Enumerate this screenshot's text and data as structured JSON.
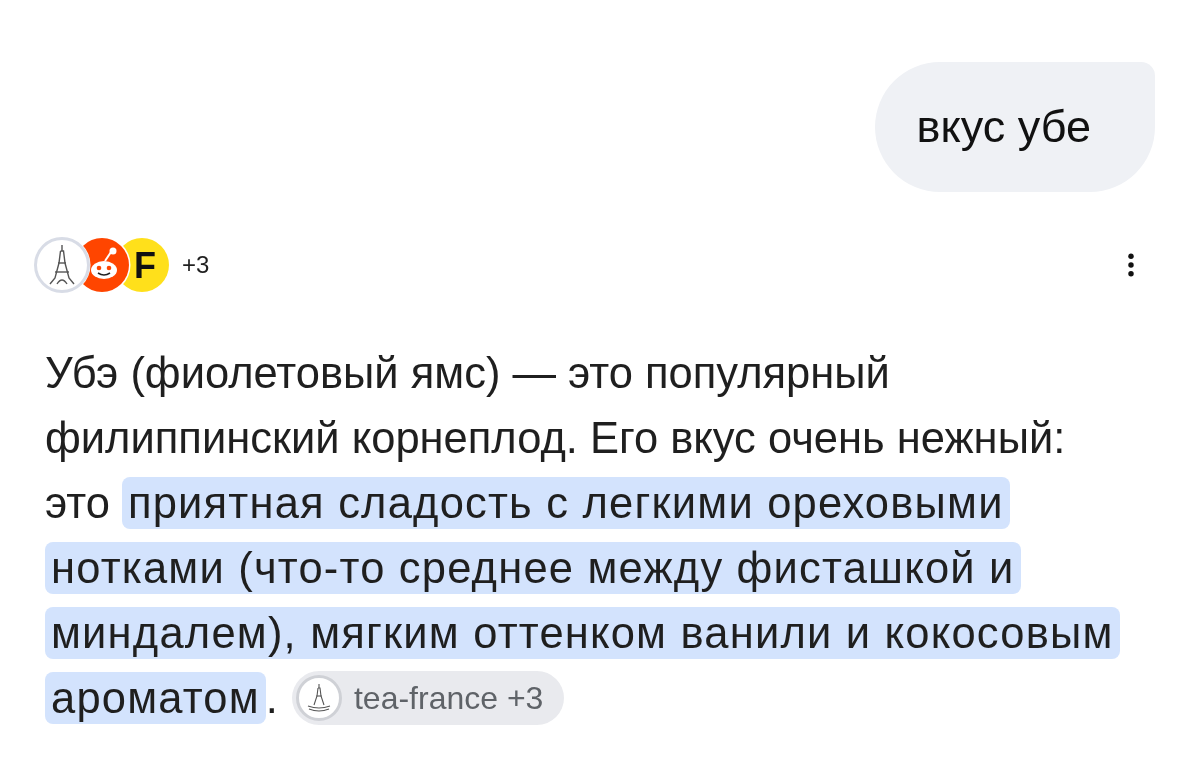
{
  "user_message": {
    "text": "вкус убе"
  },
  "response": {
    "source_icons": [
      {
        "kind": "tower"
      },
      {
        "kind": "mascot"
      },
      {
        "kind": "letter",
        "text": "F"
      }
    ],
    "more_sources": "+3",
    "segments": [
      {
        "text": "Убэ (фиолетовый ямс) — это популярный филиппинский корнеплод. Его вкус очень нежный: это ",
        "highlighted": false
      },
      {
        "text": "приятная сладость с легкими ореховыми нотками (что-то среднее между фисташкой и миндалем), мягким оттенком ванили и кокосовым ароматом",
        "highlighted": true
      },
      {
        "text": ".",
        "highlighted": false
      }
    ],
    "citation": {
      "label": "tea-france +3"
    }
  }
}
